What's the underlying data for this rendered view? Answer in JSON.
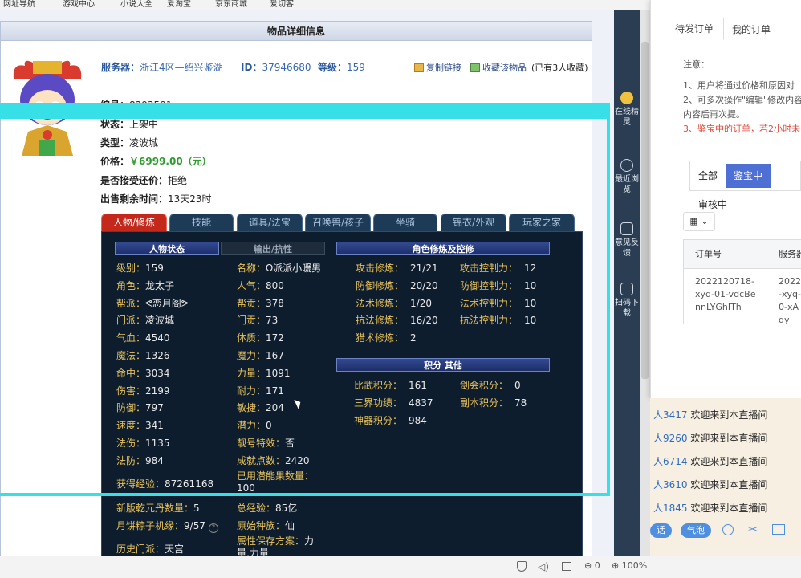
{
  "browser_bookmarks": [
    "网址导航",
    "游戏中心",
    "小说大全",
    "爱淘宝",
    "京东商城",
    "爱切客"
  ],
  "panel_title": "物品详细信息",
  "item": {
    "server_label": "服务器：",
    "server": "浙江4区—绍兴鉴湖",
    "id_label": "ID：",
    "id": "37946680",
    "level_label": "等级：",
    "level": "159",
    "copy_link": "复制链接",
    "favorite": "收藏该物品",
    "fav_count": "(已有3人收藏)",
    "number_label": "编号：",
    "number": "8293591",
    "status_label": "状态：",
    "status": "上架中",
    "type_label": "类型：",
    "type": "凌波城",
    "price_label": "价格：",
    "price": "￥6999.00（元）",
    "counter_label": "是否接受还价：",
    "counter": "拒绝",
    "remain_label": "出售剩余时间：",
    "remain": "13天23时"
  },
  "tabs": [
    "人物/修炼",
    "技能",
    "道具/法宝",
    "召唤兽/孩子",
    "坐骑",
    "锦衣/外观",
    "玩家之家"
  ],
  "headers": {
    "person": "人物状态",
    "attack": "输出/抗性",
    "cultivation": "角色修炼及控修",
    "points": "积分 其他"
  },
  "left_stats": [
    {
      "k": "级别：",
      "v": "159"
    },
    {
      "k": "角色：",
      "v": "龙太子"
    },
    {
      "k": "帮派：",
      "v": "ᕙ恋月阁ᕗ"
    },
    {
      "k": "门派：",
      "v": "凌波城"
    },
    {
      "k": "气血：",
      "v": "4540"
    },
    {
      "k": "魔法：",
      "v": "1326"
    },
    {
      "k": "命中：",
      "v": "3034"
    },
    {
      "k": "伤害：",
      "v": "2199"
    },
    {
      "k": "防御：",
      "v": "797"
    },
    {
      "k": "速度：",
      "v": "341"
    },
    {
      "k": "法伤：",
      "v": "1135"
    },
    {
      "k": "法防：",
      "v": "984"
    }
  ],
  "mid_stats": [
    {
      "k": "名称：",
      "v": "Ω派派小暖男"
    },
    {
      "k": "人气：",
      "v": "800"
    },
    {
      "k": "帮贡：",
      "v": "378"
    },
    {
      "k": "门贡：",
      "v": "73"
    },
    {
      "k": "体质：",
      "v": "172"
    },
    {
      "k": "魔力：",
      "v": "167"
    },
    {
      "k": "力量：",
      "v": "1091"
    },
    {
      "k": "耐力：",
      "v": "171"
    },
    {
      "k": "敏捷：",
      "v": "204"
    },
    {
      "k": "潜力：",
      "v": "0"
    },
    {
      "k": "靓号特效：",
      "v": "否"
    },
    {
      "k": "成就点数：",
      "v": "2420"
    }
  ],
  "cult": [
    {
      "k": "攻击修炼：",
      "v": "21/21",
      "k2": "攻击控制力：",
      "v2": "12"
    },
    {
      "k": "防御修炼：",
      "v": "20/20",
      "k2": "防御控制力：",
      "v2": "10"
    },
    {
      "k": "法术修炼：",
      "v": "1/20",
      "k2": "法术控制力：",
      "v2": "10"
    },
    {
      "k": "抗法修炼：",
      "v": "16/20",
      "k2": "抗法控制力：",
      "v2": "10"
    },
    {
      "k": "猎术修炼：",
      "v": "2",
      "k2": "",
      "v2": ""
    }
  ],
  "points": [
    {
      "k": "比武积分：",
      "v": "161",
      "k2": "剑会积分：",
      "v2": "0"
    },
    {
      "k": "三界功绩：",
      "v": "4837",
      "k2": "副本积分：",
      "v2": "78"
    },
    {
      "k": "神器积分：",
      "v": "984",
      "k2": "",
      "v2": ""
    }
  ],
  "extra": {
    "exp_label": "获得经验：",
    "exp": "87261168",
    "used_label": "已用潜能果数量：",
    "used": "100",
    "qianyuan_label": "新版乾元丹数量：",
    "qianyuan": "5",
    "total_label": "总经验：",
    "total": "85亿",
    "zongzi_label": "月饼粽子机缘：",
    "zongzi": "9/57",
    "race_label": "原始种族：",
    "race": "仙",
    "history_label": "历史门派：",
    "history": "天宫",
    "save_label": "属性保存方案：",
    "save": "力量,力量"
  },
  "sidebar": [
    {
      "label": "在线精灵"
    },
    {
      "label": "最近浏览"
    },
    {
      "label": "意见反馈"
    },
    {
      "label": "扫码下载"
    }
  ],
  "overlay": {
    "tab1": "待发订单",
    "tab2": "我的订单",
    "note_title": "注意：",
    "note1": "1、用户将通过价格和原因对",
    "note2": "2、可多次操作\"编辑\"修改内容",
    "note3": "内容后再次提。",
    "note4": "3、鉴宝中的订单，若2小时未",
    "filters": [
      "全部",
      "鉴宝中",
      "审核中"
    ],
    "col1": "订单号",
    "col2": "服务器",
    "order1": "2022120718-xyq-01-vdcBennLYGhITh",
    "order2": "2022-xyq-0-xAqy"
  },
  "chat": {
    "lines": [
      {
        "user": "人3417",
        "msg": "欢迎来到本直播间"
      },
      {
        "user": "人9260",
        "msg": "欢迎来到本直播间"
      },
      {
        "user": "人6714",
        "msg": "欢迎来到本直播间"
      },
      {
        "user": "人3610",
        "msg": "欢迎来到本直播间"
      },
      {
        "user": "人1845",
        "msg": "欢迎来到本直播间"
      }
    ],
    "btn1": "话",
    "btn2": "气泡"
  },
  "status": {
    "zoom": "100%",
    "count": "0"
  }
}
